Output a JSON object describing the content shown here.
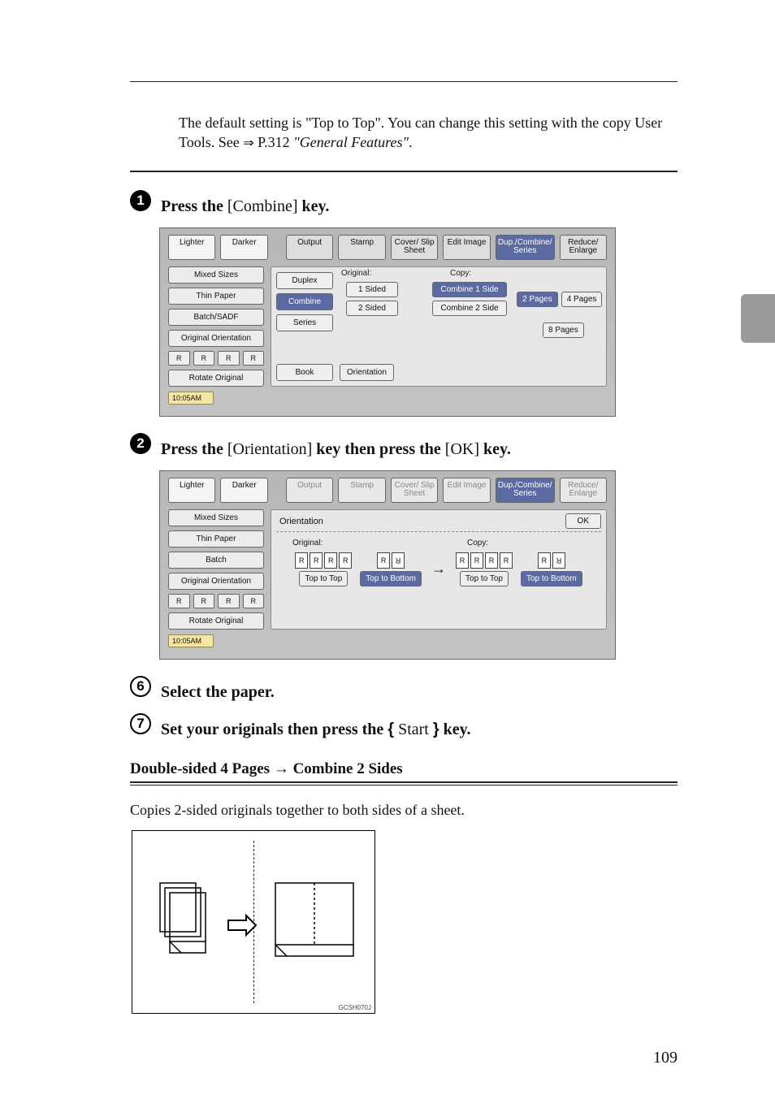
{
  "intro": {
    "preface": "The default setting is \"Top to Top\". You can change this setting with the copy User Tools. See ",
    "arrow": "⇒",
    "ref": " P.312 ",
    "ref_title": "\"General Features\"",
    "period": "."
  },
  "steps": {
    "s1": {
      "num": "1",
      "before": "Press the ",
      "key1": "[Combine]",
      "after": " key."
    },
    "s2": {
      "num": "2",
      "before": "Press the ",
      "key1": "[Orientation]",
      "mid": " key then press the ",
      "key2": "[OK]",
      "after": " key."
    },
    "s6": {
      "num": "6",
      "text": "Select the paper."
    },
    "s7": {
      "num": "7",
      "before": "Set your originals then press the ",
      "keyopen": "{",
      "key1": "Start",
      "keyclose": "}",
      "after": " key."
    }
  },
  "panel1": {
    "tabs": {
      "lighter": "Lighter",
      "darker": "Darker",
      "output": "Output",
      "stamp": "Stamp",
      "cover": "Cover/\nSlip Sheet",
      "edit": "Edit\nImage",
      "dup": "Dup./Combine/\nSeries",
      "reduce": "Reduce/\nEnlarge"
    },
    "left": [
      "Mixed Sizes",
      "Thin Paper",
      "Batch/SADF",
      "Original Orientation",
      "Rotate Original"
    ],
    "modes": {
      "duplex": "Duplex",
      "combine": "Combine",
      "series": "Series",
      "book": "Book"
    },
    "orig_label": "Original:",
    "copy_label": "Copy:",
    "orig_btns": [
      "1 Sided",
      "2 Sided"
    ],
    "copy_btns": [
      "Combine 1 Side",
      "Combine 2 Side"
    ],
    "right_btns": [
      "2 Pages",
      "4 Pages",
      "8 Pages"
    ],
    "orientation_btn": "Orientation",
    "foot": "10:05AM"
  },
  "panel2": {
    "tabs_dim": true,
    "left": [
      "Mixed Sizes",
      "Thin Paper",
      "Batch",
      "Original Orientation",
      "Rotate Original"
    ],
    "title": "Orientation",
    "ok": "OK",
    "orig_label": "Original:",
    "copy_label": "Copy:",
    "opts": {
      "tt": "Top to Top",
      "tb": "Top to Bottom"
    },
    "foot": "10:05AM"
  },
  "subsection": {
    "title": "Double-sided 4 Pages → Combine 2 Sides",
    "desc": "Copies 2-sided originals together to both sides of a sheet."
  },
  "figure": {
    "code": "GCSH070J"
  },
  "page_number": "109"
}
